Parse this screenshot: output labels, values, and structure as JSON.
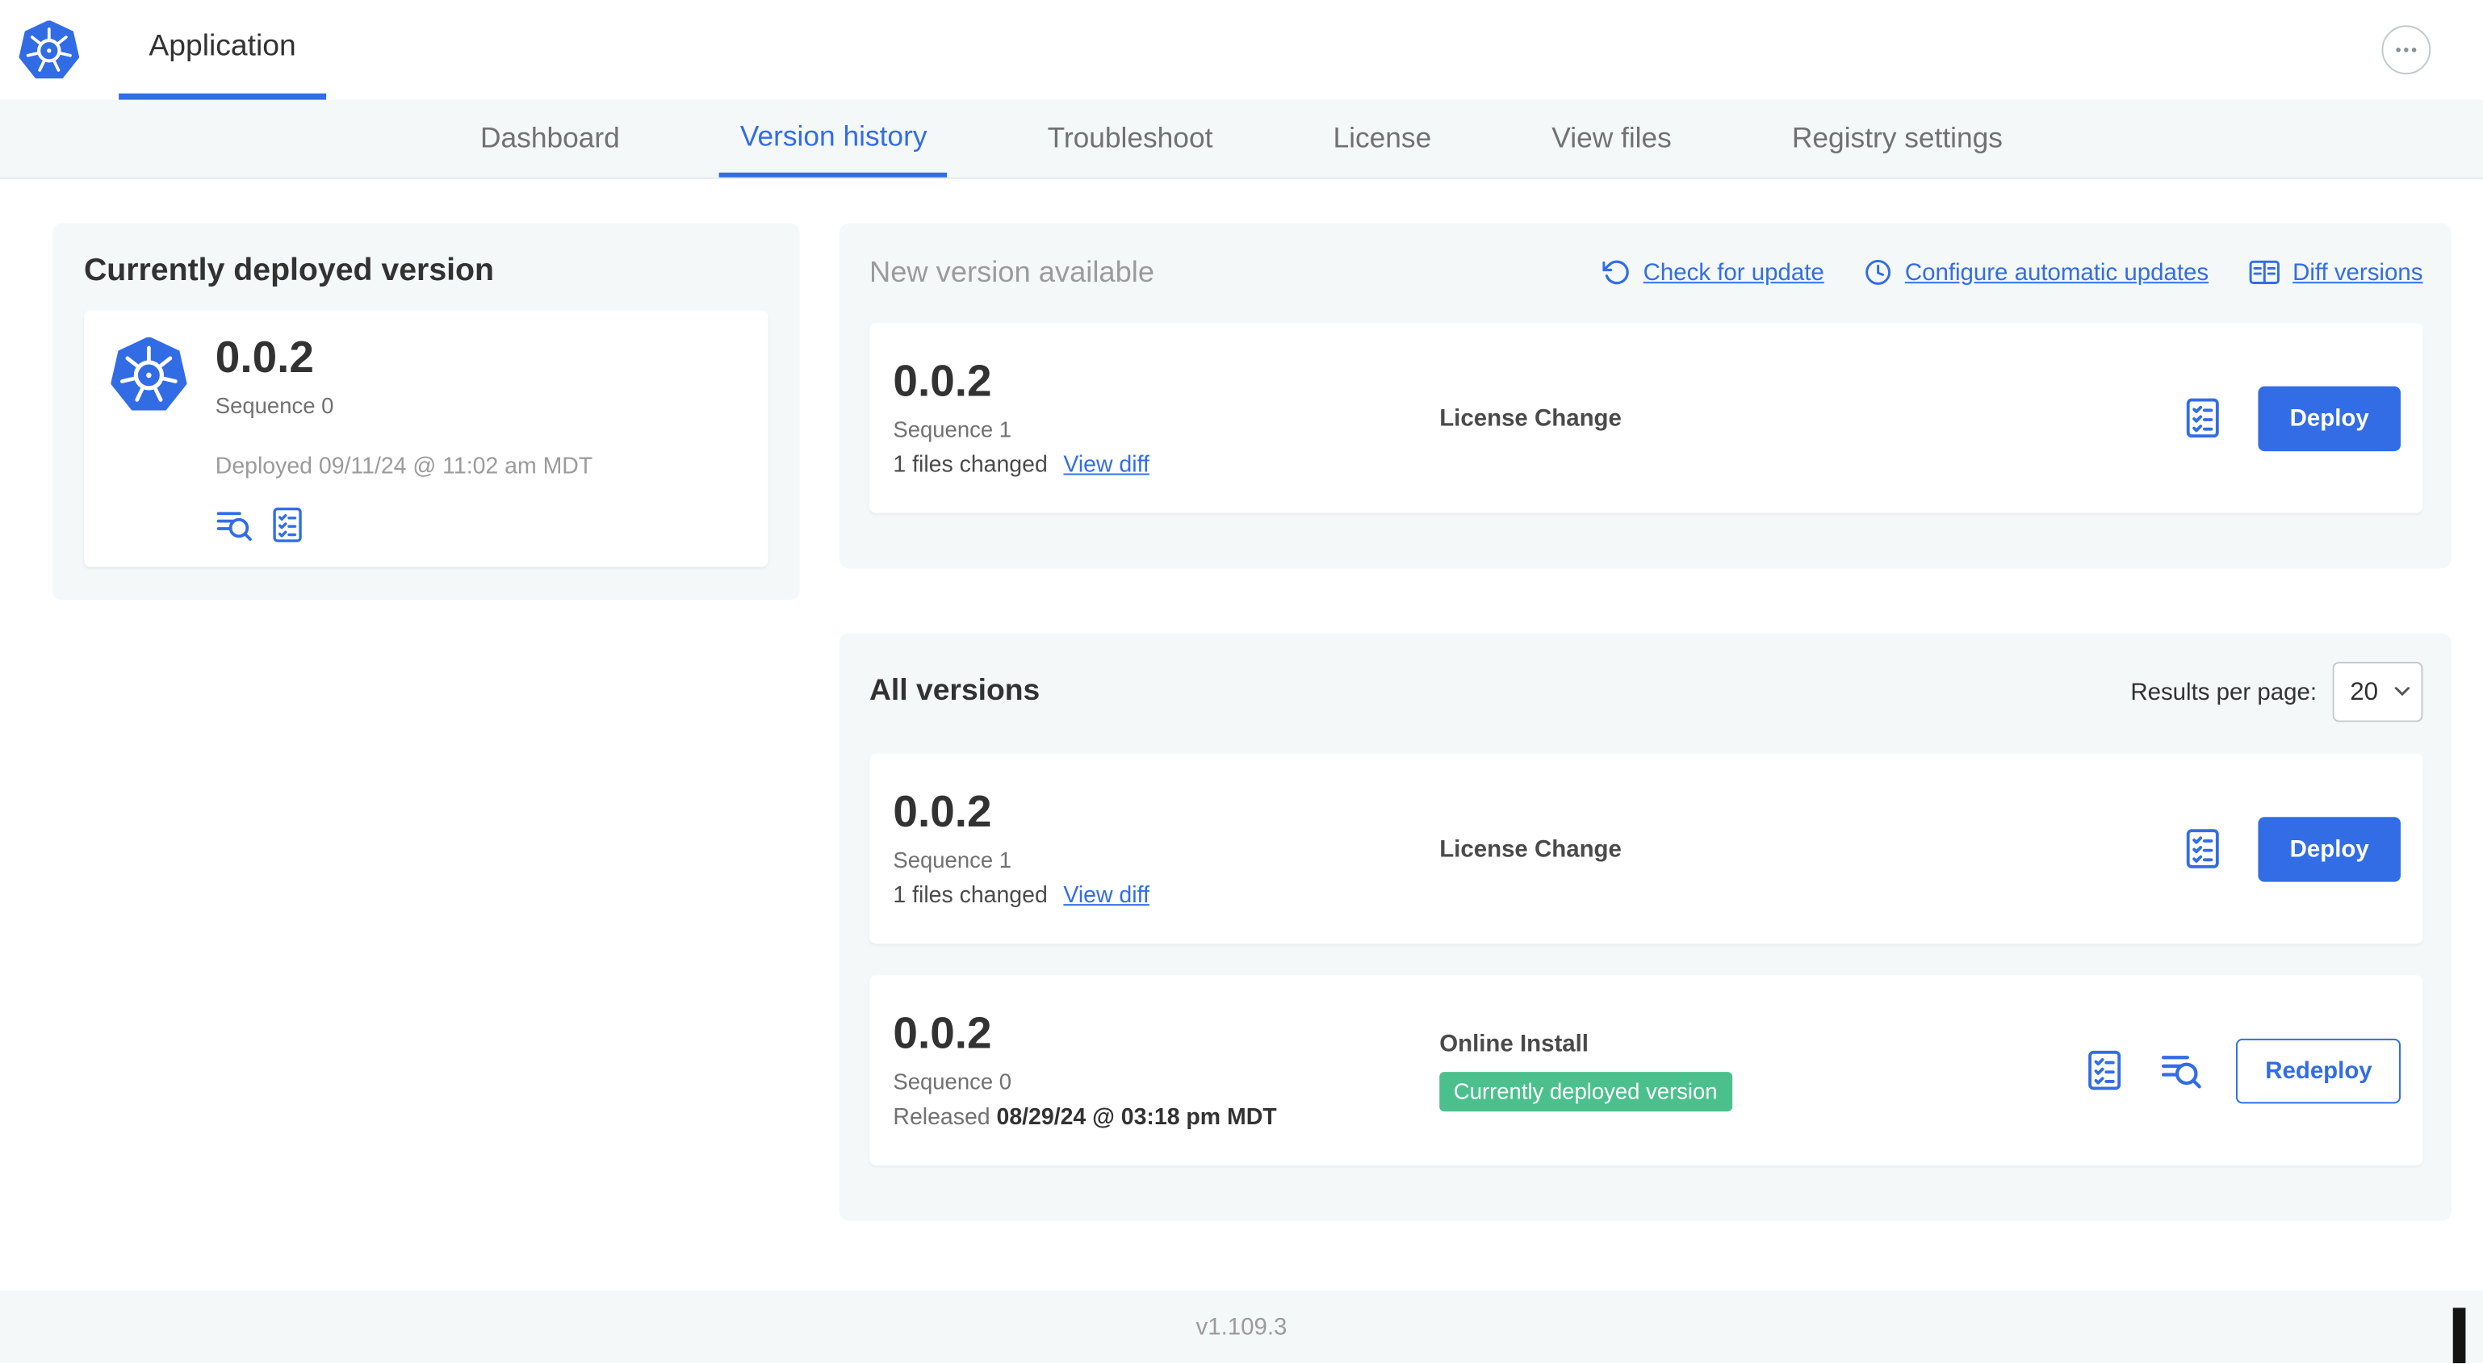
{
  "header": {
    "app_tab": "Application"
  },
  "nav": {
    "active_tab": "Version history",
    "tabs": [
      {
        "label": "Dashboard"
      },
      {
        "label": "Version history"
      },
      {
        "label": "Troubleshoot"
      },
      {
        "label": "License"
      },
      {
        "label": "View files"
      },
      {
        "label": "Registry settings"
      }
    ]
  },
  "currently_deployed": {
    "title": "Currently deployed version",
    "version": "0.0.2",
    "sequence": "Sequence 0",
    "deployed_at": "Deployed 09/11/24 @ 11:02 am MDT"
  },
  "new_version": {
    "title": "New version available",
    "actions": {
      "check_for_update": "Check for update",
      "configure_automatic_updates": "Configure automatic updates",
      "diff_versions": "Diff versions"
    },
    "card": {
      "version": "0.0.2",
      "sequence": "Sequence 1",
      "files_changed": "1 files changed",
      "view_diff": "View diff",
      "source": "License Change",
      "deploy": "Deploy"
    }
  },
  "all_versions": {
    "title": "All versions",
    "results_per_page_label": "Results per page:",
    "results_per_page": "20",
    "rows": [
      {
        "version": "0.0.2",
        "sequence": "Sequence 1",
        "files_changed": "1 files changed",
        "view_diff": "View diff",
        "source": "License Change",
        "action": "Deploy"
      },
      {
        "version": "0.0.2",
        "sequence": "Sequence 0",
        "released_prefix": "Released",
        "released_date": "08/29/24 @ 03:18 pm MDT",
        "source": "Online Install",
        "badge": "Currently deployed version",
        "action": "Redeploy"
      }
    ]
  },
  "footer": {
    "app_version": "v1.109.3"
  },
  "icons": {
    "kubernetes_logo": "⎈",
    "more_options": "⋯",
    "release_notes": "≡⌕",
    "preflight_checks": "☑",
    "check_for_update": "↺",
    "configure_automatic_updates": "🕒",
    "diff_versions": "▦",
    "select_chevron": "⌄"
  },
  "colors": {
    "accent_blue": "#326de6",
    "k8s_blue": "#326ce5",
    "badge_green": "#4cc08c",
    "section_bg": "#f5f8f9",
    "text_dark": "#323232",
    "text_mid": "#717171",
    "text_gray": "#9b9b9b"
  }
}
